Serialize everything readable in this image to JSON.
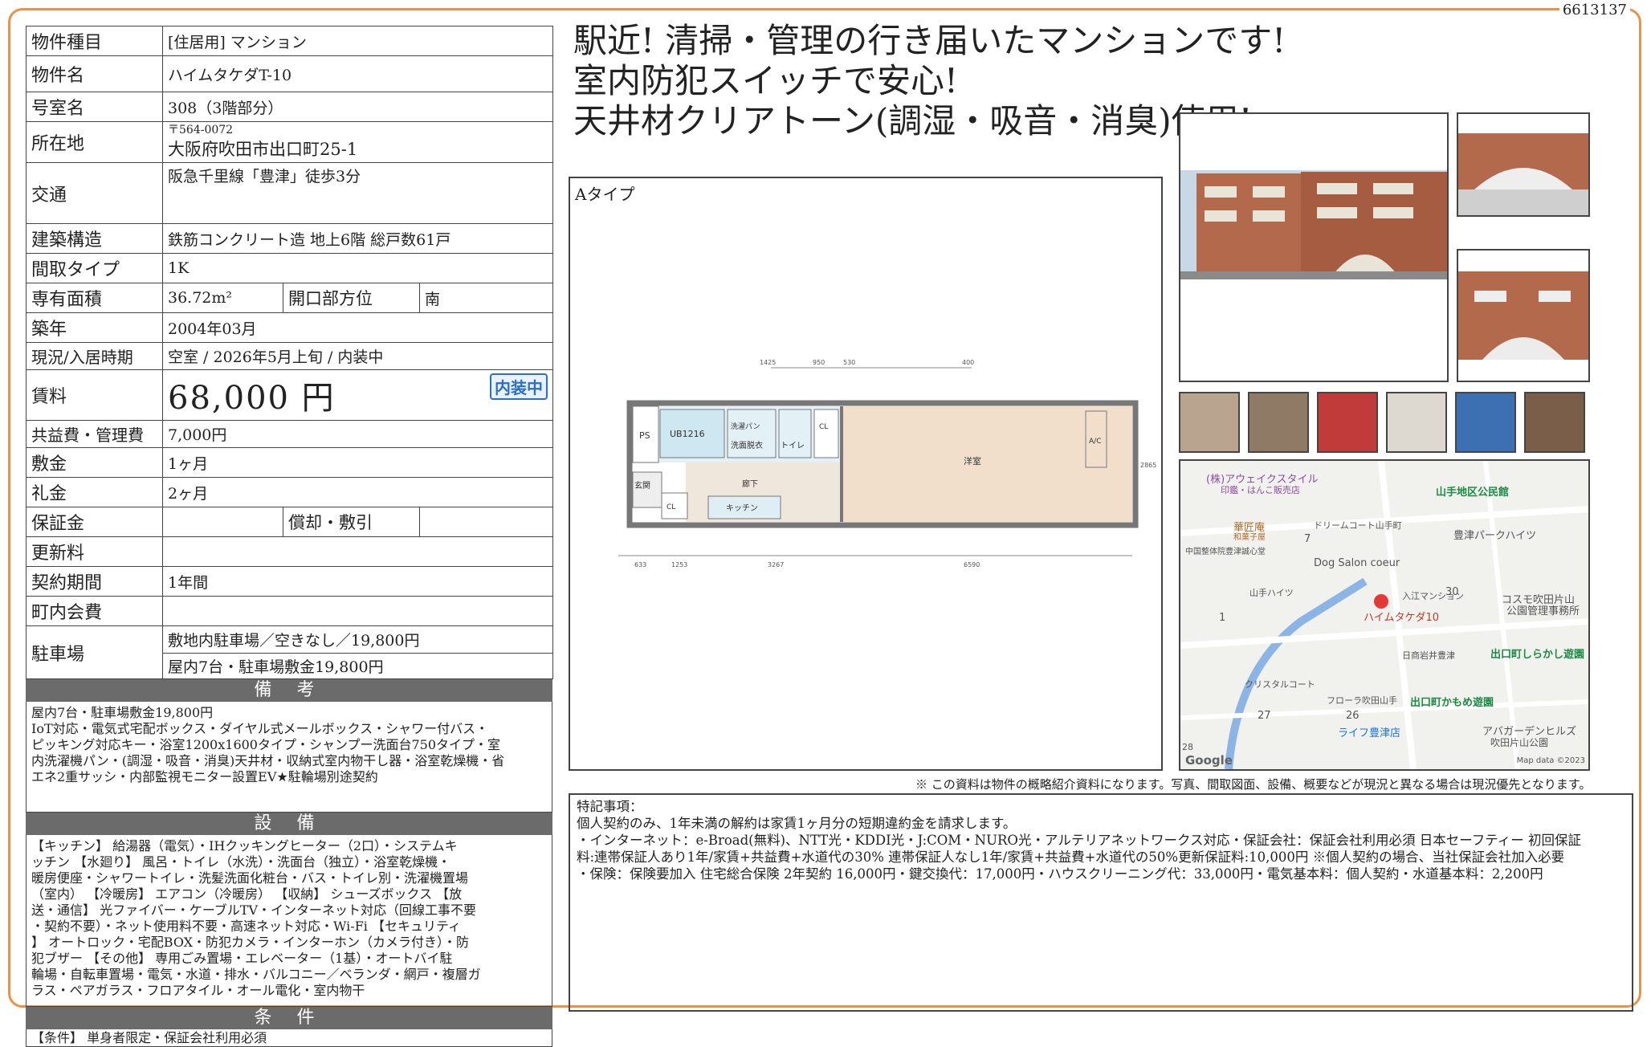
{
  "ref_no": "6613137",
  "headline": [
    "駅近! 清掃・管理の行き届いたマンションです!",
    "室内防犯スイッチで安心!",
    "天井材クリアトーン(調湿・吸音・消臭)使用!"
  ],
  "spec": {
    "type_label": "物件種目",
    "type_value": "[住居用]  マンション",
    "name_label": "物件名",
    "name_value": "ハイムタケダT-10",
    "room_label": "号室名",
    "room_value": "308（3階部分）",
    "addr_label": "所在地",
    "zip": "〒564-0072",
    "addr_value": "大阪府吹田市出口町25-1",
    "access_label": "交通",
    "access_value": "阪急千里線「豊津」徒歩3分",
    "structure_label": "建築構造",
    "structure_value": "鉄筋コンクリート造 地上6階 総戸数61戸",
    "layout_label": "間取タイプ",
    "layout_value": "1K",
    "area_label": "専有面積",
    "area_value": "36.72m²",
    "dir_label": "開口部方位",
    "dir_value": "南",
    "built_label": "築年",
    "built_value": "2004年03月",
    "status_label": "現況/入居時期",
    "status_value": "空室  /  2026年5月上旬  /  内装中",
    "rent_label": "賃料",
    "rent_value": "68,000 円",
    "badge": "内装中",
    "fee_label": "共益費・管理費",
    "fee_value": "7,000円",
    "deposit_label": "敷金",
    "deposit_value": "1ヶ月",
    "key_label": "礼金",
    "key_value": "2ヶ月",
    "guarantee_label": "保証金",
    "amort_label": "償却・敷引",
    "renew_label": "更新料",
    "contract_label": "契約期間",
    "contract_value": "1年間",
    "town_label": "町内会費",
    "parking_label": "駐車場",
    "parking_value1": "敷地内駐車場／空きなし／19,800円",
    "parking_value2": "屋内7台・駐車場敷金19,800円"
  },
  "remarks": {
    "title": "備 考",
    "lines": [
      "屋内7台・駐車場敷金19,800円",
      "IoT対応・電気式宅配ボックス・ダイヤル式メールボックス・シャワー付バス・",
      "ピッキング対応キー・浴室1200x1600タイプ・シャンプー洗面台750タイプ・室",
      "内洗濯機パン・(調湿・吸音・消臭)天井材・収納式室内物干し器・浴室乾燥機・省",
      "エネ2重サッシ・内部監視モニター設置EV★駐輪場別途契約"
    ]
  },
  "facilities": {
    "title": "設 備",
    "lines": [
      "【キッチン】 給湯器（電気）・IHクッキングヒーター（2口）・システムキ",
      "ッチン 【水廻り】 風呂・トイレ（水洗）・洗面台（独立）・浴室乾燥機・",
      "暖房便座・シャワートイレ・洗髪洗面化粧台・バス・トイレ別・洗濯機置場",
      "（室内） 【冷暖房】 エアコン（冷暖房） 【収納】 シューズボックス 【放",
      "送・通信】 光ファイバー・ケーブルTV・インターネット対応（回線工事不要",
      "・契約不要）・ネット使用料不要・高速ネット対応・Wi-Fi 【セキュリティ",
      "】 オートロック・宅配BOX・防犯カメラ・インターホン（カメラ付き）・防",
      "犯ブザー 【その他】 専用ごみ置場・エレベーター（1基）・オートバイ駐",
      "輪場・自転車置場・電気・水道・排水・バルコニー／ベランダ・網戸・複層ガ",
      "ラス・ペアガラス・フロアタイル・オール電化・室内物干"
    ]
  },
  "conditions": {
    "title": "条 件",
    "lines": [
      "【条件】 単身者限定・保証会社利用必須"
    ]
  },
  "floorplan": {
    "title": "Aタイプ",
    "rooms": [
      "PS",
      "UB1216",
      "洗濯パン",
      "洗面脱衣",
      "トイレ",
      "CL",
      "洋室",
      "A/C",
      "玄関",
      "CL",
      "廊下",
      "キッチン"
    ],
    "dims": [
      "1425",
      "950",
      "530",
      "400",
      "633",
      "1253",
      "3267",
      "6590",
      "2865"
    ]
  },
  "map": {
    "labels": [
      "(株)アウェイクスタイル",
      "印鑑・はんこ販売店",
      "山手地区公民館",
      "豊津パークハイツ",
      "華匠庵",
      "和菓子屋",
      "ドリームコート山手町",
      "中国整体院豊津誠心堂",
      "Dog Salon coeur",
      "山手ハイツ",
      "入江マンション",
      "コスモ吹田片山",
      "公園管理事務所",
      "ハイムタケダ10",
      "日商岩井豊津",
      "出口町しらかし遊園",
      "クリスタルコート",
      "フローラ吹田山手",
      "出口町かもめ遊園",
      "ライフ豊津店",
      "アバガーデンヒルズ",
      "吹田片山公園",
      "7",
      "30",
      "1",
      "26",
      "27",
      "28"
    ],
    "brand": "Google",
    "credit": "Map data ©2023"
  },
  "note": "※ この資料は物件の概略紹介資料になります。写真、間取図面、設備、概要などが現況と異なる場合は現況優先となります。",
  "special": {
    "lines": [
      "特記事項：",
      "個人契約のみ、1年未満の解約は家賃1ヶ月分の短期違約金を請求します。",
      "・インターネット：e-Broad(無料)、NTT光・KDDI光・J:COM・NURO光・アルテリアネットワークス対応・保証会社：保証会社利用必須 日本セーフティー 初回保証",
      "料:連帯保証人あり1年/家賃+共益費+水道代の30% 連帯保証人なし1年/家賃+共益費+水道代の50%更新保証料:10,000円 ※個人契約の場合、当社保証会社加入必要",
      "・保険：保険要加入 住宅総合保険 2年契約 16,000円・鍵交換代：17,000円・ハウスクリーニング代：33,000円・電気基本料：個人契約・水道基本料：2,200円"
    ]
  }
}
